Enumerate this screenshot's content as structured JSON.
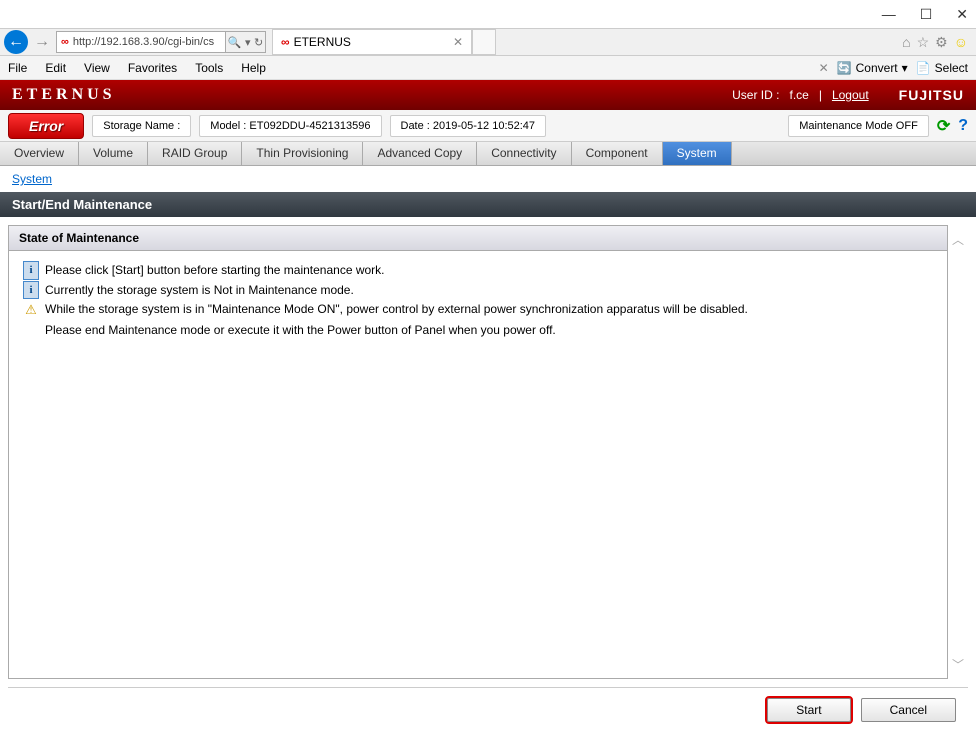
{
  "window": {
    "min": "—",
    "max": "☐",
    "close": "✕"
  },
  "browser": {
    "url": "http://192.168.3.90/cgi-bin/cs",
    "tab_title": "ETERNUS"
  },
  "menu": {
    "items": [
      "File",
      "Edit",
      "View",
      "Favorites",
      "Tools",
      "Help"
    ],
    "close_x": "✕",
    "convert": "Convert",
    "select": "Select"
  },
  "header": {
    "logo": "ETERNUS",
    "user_label": "User ID :",
    "user_id": "f.ce",
    "logout": "Logout",
    "vendor": "FUJITSU"
  },
  "status": {
    "error": "Error",
    "storage_name_label": "Storage Name :",
    "model": "Model : ET092DDU-4521313596",
    "date": "Date : 2019-05-12 10:52:47",
    "maintenance_mode": "Maintenance Mode OFF"
  },
  "tabs": [
    "Overview",
    "Volume",
    "RAID Group",
    "Thin Provisioning",
    "Advanced Copy",
    "Connectivity",
    "Component",
    "System"
  ],
  "active_tab_index": 7,
  "breadcrumb": {
    "system": "System"
  },
  "section_title": "Start/End Maintenance",
  "panel": {
    "title": "State of Maintenance",
    "msg1": "Please click [Start] button before starting the maintenance work.",
    "msg2": "Currently the storage system is Not in Maintenance mode.",
    "msg3": "While the storage system is in \"Maintenance Mode ON\", power control by external power synchronization apparatus will be disabled.",
    "msg3b": "Please end Maintenance mode or execute it with the Power button of Panel when you power off."
  },
  "footer": {
    "start": "Start",
    "cancel": "Cancel"
  }
}
